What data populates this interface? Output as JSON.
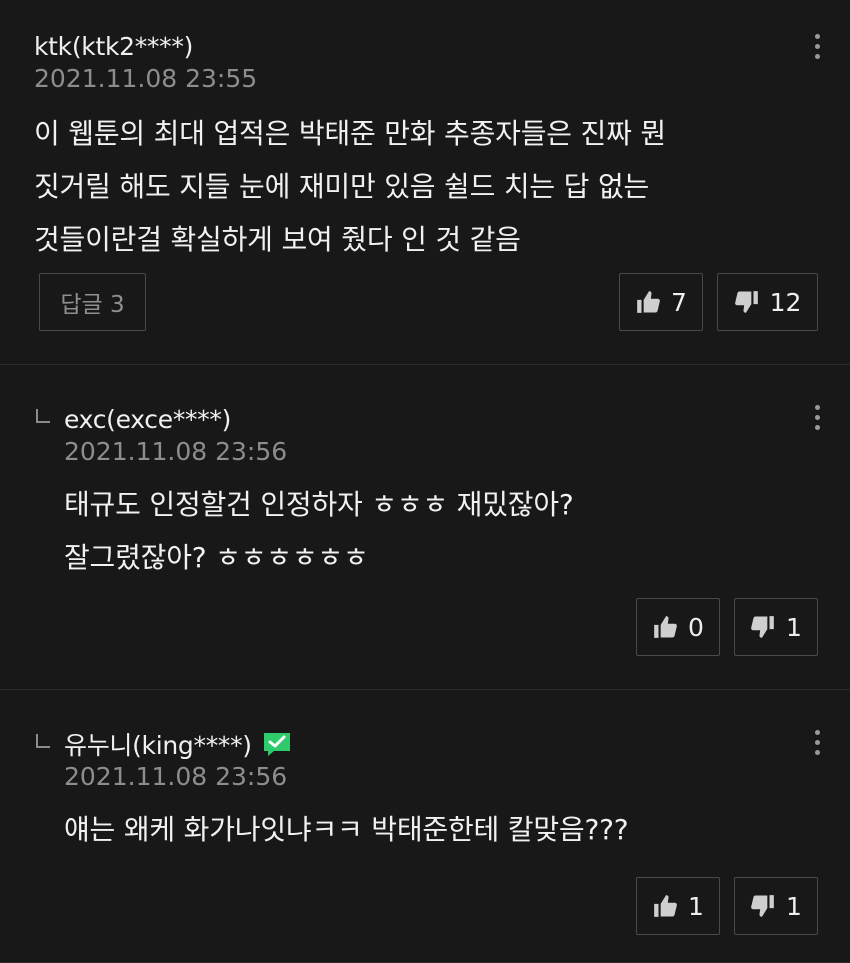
{
  "comments": [
    {
      "author": "ktk(ktk2****)",
      "date": "2021.11.08 23:55",
      "text": "이 웹툰의 최대 업적은 박태준 만화 추종자들은 진짜 뭔\n짓거릴 해도 지들 눈에 재미만 있음 쉴드 치는 답 없는\n것들이란걸 확실하게 보여 줬다 인 것 같음",
      "reply_label": "답글 3",
      "likes": "7",
      "dislikes": "12"
    },
    {
      "author": "exc(exce****)",
      "date": "2021.11.08 23:56",
      "text": "태규도 인정할건 인정하자 ㅎㅎㅎ 재밌잖아?\n잘그렸잖아? ㅎㅎㅎㅎㅎㅎ",
      "likes": "0",
      "dislikes": "1"
    },
    {
      "author": "유누니(king****)",
      "date": "2021.11.08 23:56",
      "text": "얘는 왜케 화가나잇냐ㅋㅋ 박태준한테 칼맞음???",
      "likes": "1",
      "dislikes": "1"
    }
  ],
  "icons": {
    "like": "thumbs-up-icon",
    "dislike": "thumbs-down-icon",
    "more": "more-vertical-icon",
    "reply_arrow": "reply-arrow-icon",
    "verified": "verified-badge-icon"
  },
  "colors": {
    "background": "#181818",
    "verified_badge": "#2fca6b"
  }
}
